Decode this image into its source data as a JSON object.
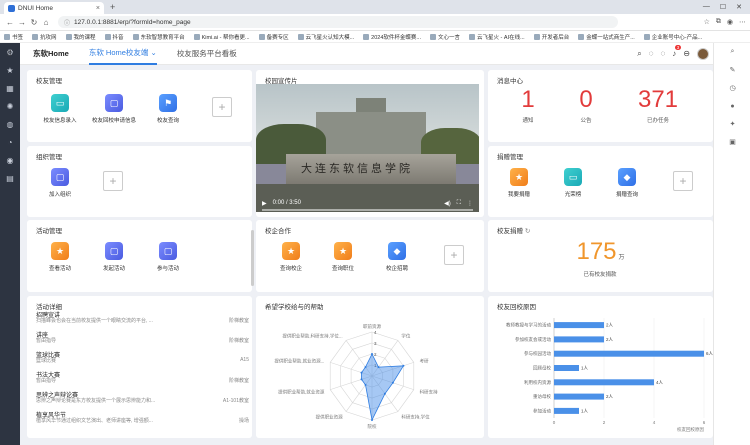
{
  "browser": {
    "tab_title": "DNUI Home",
    "url": "127.0.0.1:8881/erp/?formId=home_page",
    "bookmarks": [
      "书签",
      "抗攻网",
      "我的课程",
      "抖音",
      "东软智慧教育平台",
      "Kimi.ai - 帮你看更...",
      "备赛专区",
      "云飞星火认知大模...",
      "2024软件杯金蝶赛...",
      "文心一言",
      "云飞星火 - AI在线...",
      "开发者后台",
      "金蝶一站式商生产...",
      "企业账号中心-产品..."
    ]
  },
  "app": {
    "brand": "东软Home",
    "nav_tabs": [
      {
        "label": "东软 Home校友端 ⌄",
        "active": true
      },
      {
        "label": "校友服务平台看板",
        "active": false
      }
    ],
    "notif_count": "3"
  },
  "alumni_mgmt": {
    "title": "校友管理",
    "items": [
      {
        "label": "校友信息录入",
        "color": "teal",
        "icon": "monitor-icon"
      },
      {
        "label": "校友回校申请信息",
        "color": "indigo",
        "icon": "square-icon"
      },
      {
        "label": "校友查询",
        "color": "blue",
        "icon": "bookmark-icon"
      }
    ]
  },
  "org_mgmt": {
    "title": "组织管理",
    "items": [
      {
        "label": "加入组织",
        "color": "indigo",
        "icon": "square-icon"
      }
    ]
  },
  "activity_mgmt": {
    "title": "活动管理",
    "items": [
      {
        "label": "查看活动",
        "color": "orange",
        "icon": "star-icon"
      },
      {
        "label": "发起活动",
        "color": "indigo",
        "icon": "square-icon"
      },
      {
        "label": "参与活动",
        "color": "indigo",
        "icon": "square-icon"
      }
    ]
  },
  "promo": {
    "title": "校园宣传片",
    "sign_text": "大连东软信息学院",
    "time": "0:00 / 3:50"
  },
  "cooperation": {
    "title": "校企合作",
    "items": [
      {
        "label": "查询校企",
        "color": "orange",
        "icon": "star-icon"
      },
      {
        "label": "查询职位",
        "color": "orange",
        "icon": "star-icon"
      },
      {
        "label": "校企招聘",
        "color": "blue",
        "icon": "cube-icon"
      }
    ]
  },
  "messages": {
    "title": "消息中心",
    "items": [
      {
        "value": "1",
        "label": "通知"
      },
      {
        "value": "0",
        "label": "公告"
      },
      {
        "value": "371",
        "label": "已办任务"
      }
    ]
  },
  "donation_mgmt": {
    "title": "捐赠管理",
    "items": [
      {
        "label": "我要捐赠",
        "color": "orange",
        "icon": "star-icon"
      },
      {
        "label": "光荣榜",
        "color": "teal",
        "icon": "monitor-icon"
      },
      {
        "label": "捐赠查询",
        "color": "blue",
        "icon": "cube-icon"
      }
    ]
  },
  "donation_total": {
    "title": "校友捐赠",
    "value": "175",
    "unit": "万",
    "label": "已有校友捐款"
  },
  "activity_detail": {
    "title": "活动详细",
    "items": [
      {
        "title": "招聘宣讲",
        "desc": "扫描峰会也会在当前校友提供一个眼睛交流的平台, ...",
        "right": "阶梯教室"
      },
      {
        "title": "讲座",
        "desc": "暂由指导",
        "right": "阶梯教室"
      },
      {
        "title": "篮球比赛",
        "desc": "篮球比赛",
        "right": "A15"
      },
      {
        "title": "书法大赛",
        "desc": "暂由指导",
        "right": "阶梯教室"
      },
      {
        "title": "思辨之声辩论赛",
        "desc": "思辨之声辩论赛是东方校友提供一个展示思辨能力和...",
        "right": "A1-101教室"
      },
      {
        "title": "植享风华节",
        "desc": "植享风华节通过组织文艺演出、老师讲座等, 增强额...",
        "right": "操场"
      }
    ]
  },
  "chart_data": [
    {
      "type": "radar",
      "title": "希望学校给与的帮助",
      "axes": [
        "职前资源",
        "学位",
        "考研",
        "科研支持",
        "科研支持,学位",
        "院校",
        "提供职业资源",
        "提供职业帮助,就业资源",
        "提供职业帮助,就业资源...",
        "提供职业帮助,科研支持,学位..."
      ],
      "values": [
        2,
        1,
        3,
        2,
        2,
        4,
        1,
        1,
        1,
        1
      ],
      "rings": [
        "1",
        "2",
        "3",
        "4"
      ],
      "max": 4
    },
    {
      "type": "bar",
      "orientation": "horizontal",
      "title": "校友回校原因",
      "categories": [
        "教师教授与学习的活动",
        "参加校友会或活动",
        "参与校园活动",
        "回顾母校",
        "利用校内资源",
        "重访母校",
        "参加活动"
      ],
      "values": [
        2,
        2,
        6,
        1,
        4,
        2,
        1
      ],
      "labels": [
        "2人",
        "2人",
        "6人",
        "1人",
        "4人",
        "2人",
        "1人"
      ],
      "xticks": [
        "0",
        "2",
        "4",
        "6"
      ],
      "xlim": [
        0,
        6
      ],
      "xlabel": "校友回校原因"
    }
  ]
}
